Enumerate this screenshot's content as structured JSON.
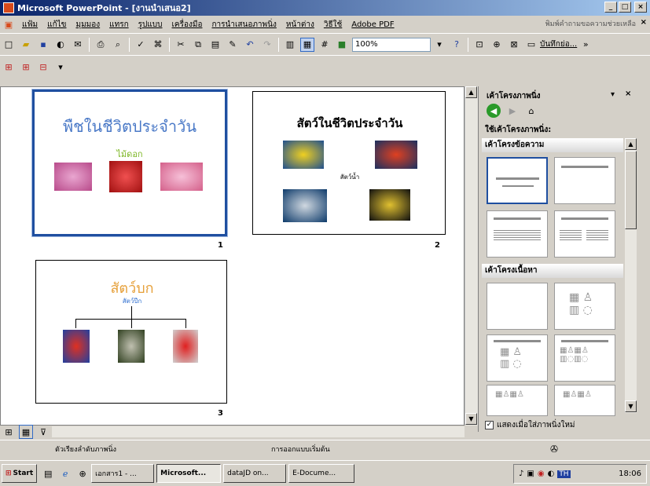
{
  "window": {
    "title": "Microsoft PowerPoint - [งานนำเสนอ2]"
  },
  "menu": {
    "items": [
      "แฟ้ม",
      "แก้ไข",
      "มุมมอง",
      "แทรก",
      "รูปแบบ",
      "เครื่องมือ",
      "การนำเสนอภาพนิ่ง",
      "หน้าต่าง",
      "วิธีใช้",
      "Adobe PDF"
    ],
    "help_placeholder": "พิมพ์คำถามขอความช่วยเหลือ"
  },
  "toolbar": {
    "zoom": "100%",
    "comment_label": "บันทึกย่อ..."
  },
  "slides": [
    {
      "number": "1",
      "title": "พืชในชีวิตประจำวัน",
      "subtitle": "ไม้ดอก",
      "title_color": "#4a79c7",
      "subtitle_color": "#7ab520",
      "selected": true
    },
    {
      "number": "2",
      "title": "สัตว์ในชีวิตประจำวัน",
      "subtitle": "สัตว์น้ำ",
      "title_color": "#000000",
      "subtitle_color": "#000000"
    },
    {
      "number": "3",
      "title": "สัตว์บก",
      "subtitle": "สัตว์ปีก",
      "title_color": "#e6a03a",
      "subtitle_color": "#2f6fd0"
    }
  ],
  "taskpane": {
    "title": "เค้าโครงภาพนิ่ง",
    "apply_label": "ใช้เค้าโครงภาพนิ่ง:",
    "section_text": "เค้าโครงข้อความ",
    "section_content": "เค้าโครงเนื้อหา",
    "show_on_insert": "แสดงเมื่อใส่ภาพนิ่งใหม่"
  },
  "statusbar": {
    "sorter": "ตัวเรียงลำดับภาพนิ่ง",
    "design": "การออกแบบเริ่มต้น"
  },
  "taskbar": {
    "start": "Start",
    "tasks": [
      "เอกสาร1 - ...",
      "Microsoft...",
      "dataJD on...",
      "E-Docume..."
    ],
    "clock": "18:06",
    "lang": "TH"
  }
}
